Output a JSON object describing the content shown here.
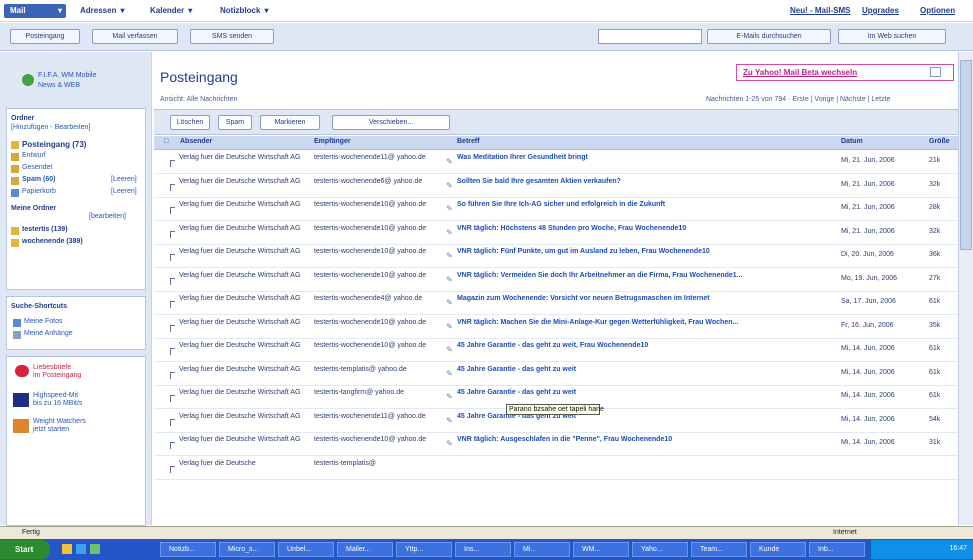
{
  "nav": {
    "mail": "Mail",
    "tabs": [
      "Adressen",
      "Kalender",
      "Notizblock"
    ],
    "right_links": [
      "Neu! - Mail-SMS",
      "Upgrades",
      "Optionen"
    ]
  },
  "toolbar": {
    "posteingang": "Posteingang",
    "mail_verfassen": "Mail verfassen",
    "sms_senden": "SMS senden",
    "search_placeholder": "",
    "emails_search": "E-Mails durchsuchen",
    "web_search": "Im Web suchen"
  },
  "sidebar": {
    "promo": [
      "F.I.F.A. WM Mobile",
      "News & WEB"
    ],
    "ordner_label": "Ordner",
    "ordner_links": "[Hinzufügen - Bearbeiten]",
    "folders": [
      {
        "label": "Posteingang (73)",
        "bold": true,
        "action": ""
      },
      {
        "label": "Entwurf",
        "bold": false,
        "action": ""
      },
      {
        "label": "Gesendet",
        "bold": false,
        "action": ""
      },
      {
        "label": "Spam (60)",
        "bold": true,
        "action": "[Leeren]"
      },
      {
        "label": "Papierkorb",
        "bold": false,
        "action": "[Leeren]"
      }
    ],
    "meine_ordner_label": "Meine Ordner",
    "meine_ordner_action": "[bearbeiten]",
    "my_folders": [
      "testertis (139)",
      "wochenende (389)"
    ],
    "suche_label": "Suche-Shortcuts",
    "suche_items": [
      "Meine Fotos",
      "Meine Anhänge"
    ],
    "ads": [
      {
        "text": [
          "Liebesbriefe",
          "im Posteingang"
        ],
        "color": "#d6233b"
      },
      {
        "text": [
          "Highspeed-Mit",
          "bis zu 16 MBit/s"
        ],
        "color": "#1b2f86"
      },
      {
        "text": [
          "Weight Watchers",
          "jetzt starten"
        ],
        "color": "#e0852a"
      }
    ]
  },
  "main": {
    "title": "Posteingang",
    "brand_link": "Zu Yahoo! Mail Beta wechseln",
    "ansicht": "Ansicht: Alle Nachrichten",
    "pager": "Nachrichten 1-25 von 794 · Erste | Vorige | Nächste | Letzte",
    "actions": [
      "Löschen",
      "Spam",
      "Markieren",
      "Verschieben..."
    ],
    "columns": [
      "Absender",
      "Empfänger",
      "Betreff",
      "Datum",
      "Größe"
    ],
    "tooltip": "Parano bzsahe oet tapeli hane",
    "rows": [
      {
        "from": "Verlag fuer die Deutsche Wirtschaft AG",
        "to": "testertis-wochenende11@ yahoo.de",
        "subject": "Was Meditation Ihrer Gesundheit bringt",
        "date": "Mi, 21. Jun, 2006",
        "size": "21k"
      },
      {
        "from": "Verlag fuer die Deutsche Wirtschaft AG",
        "to": "testertis-wochenende6@ yahoo.de",
        "subject": "Sollten Sie bald Ihre gesamten Aktien verkaufen?",
        "date": "Mi, 21. Jun, 2006",
        "size": "32k"
      },
      {
        "from": "Verlag fuer die Deutsche Wirtschaft AG",
        "to": "testertis-wochenende10@ yahoo.de",
        "subject": "So führen Sie Ihre Ich-AG sicher und erfolgreich in die Zukunft",
        "date": "Mi, 21. Jun, 2006",
        "size": "28k"
      },
      {
        "from": "Verlag fuer die Deutsche Wirtschaft AG",
        "to": "testertis-wochenende10@ yahoo.de",
        "subject": "VNR täglich: Höchstens 48 Stunden pro Woche, Frau Wochenende10",
        "date": "Mi, 21. Jun, 2006",
        "size": "32k"
      },
      {
        "from": "Verlag fuer die Deutsche Wirtschaft AG",
        "to": "testertis-wochenende10@ yahoo.de",
        "subject": "VNR täglich: Fünf Punkte, um gut im Ausland zu leben, Frau Wochenende10",
        "date": "Di, 20. Jun, 2006",
        "size": "36k"
      },
      {
        "from": "Verlag fuer die Deutsche Wirtschaft AG",
        "to": "testertis-wochenende10@ yahoo.de",
        "subject": "VNR täglich: Vermeiden Sie doch Ihr Arbeitnehmer an die Firma, Frau Wochenende1...",
        "date": "Mo, 19. Jun, 2006",
        "size": "27k"
      },
      {
        "from": "Verlag fuer die Deutsche Wirtschaft AG",
        "to": "testertis-wochenende4@ yahoo.de",
        "subject": "Magazin zum Wochenende: Vorsicht vor neuen Betrugsmaschen im Internet",
        "date": "Sa, 17. Jun, 2006",
        "size": "61k"
      },
      {
        "from": "Verlag fuer die Deutsche Wirtschaft AG",
        "to": "testertis-wochenende10@ yahoo.de",
        "subject": "VNR täglich: Machen Sie die Mini-Anlage-Kur gegen Wetterfühligkeit, Frau Wochen...",
        "date": "Fr, 16. Jun, 2006",
        "size": "35k"
      },
      {
        "from": "Verlag fuer die Deutsche Wirtschaft AG",
        "to": "testertis-wochenende10@ yahoo.de",
        "subject": "45 Jahre Garantie - das geht zu weit, Frau Wochenende10",
        "date": "Mi, 14. Jun, 2006",
        "size": "61k"
      },
      {
        "from": "Verlag fuer die Deutsche Wirtschaft AG",
        "to": "testertis-templatis@ yahoo.de",
        "subject": "45 Jahre Garantie - das geht zu weit",
        "date": "Mi, 14. Jun, 2006",
        "size": "61k"
      },
      {
        "from": "Verlag fuer die Deutsche Wirtschaft AG",
        "to": "testertis-tangfirm@ yahoo.de",
        "subject": "45 Jahre Garantie - das geht zu weit",
        "date": "Mi, 14. Jun, 2006",
        "size": "61k"
      },
      {
        "from": "Verlag fuer die Deutsche Wirtschaft AG",
        "to": "testertis-wochenende11@ yahoo.de",
        "subject": "45 Jahre Garantie - das geht zu weit",
        "date": "Mi, 14. Jun, 2006",
        "size": "54k"
      },
      {
        "from": "Verlag fuer die Deutsche Wirtschaft AG",
        "to": "testertis-wochenende10@ yahoo.de",
        "subject": "VNR täglich: Ausgeschlafen in die \"Penne\", Frau Wochenende10",
        "date": "Mi, 14. Jun, 2006",
        "size": "31k"
      },
      {
        "from": "Verlag fuer die Deutsche",
        "to": "testertis-templatis@",
        "subject": "",
        "date": "",
        "size": ""
      }
    ]
  },
  "status": {
    "left": "Fertig",
    "right": "Internet"
  },
  "taskbar": {
    "start": "Start",
    "buttons": [
      "Notizb...",
      "Micro_s...",
      "Unbel...",
      "Mailer...",
      "Yttp...",
      "Ins...",
      "Mi..",
      "WM...",
      "Yaho...",
      "Team...",
      "Kunde",
      "Inb..."
    ],
    "clock": "16:47"
  },
  "colors": {
    "accent": "#3b64b6",
    "panel": "#dfe7f5",
    "link": "#1e4bb8",
    "brand_pink": "#c21f85",
    "taskbar": "#2456c8"
  }
}
